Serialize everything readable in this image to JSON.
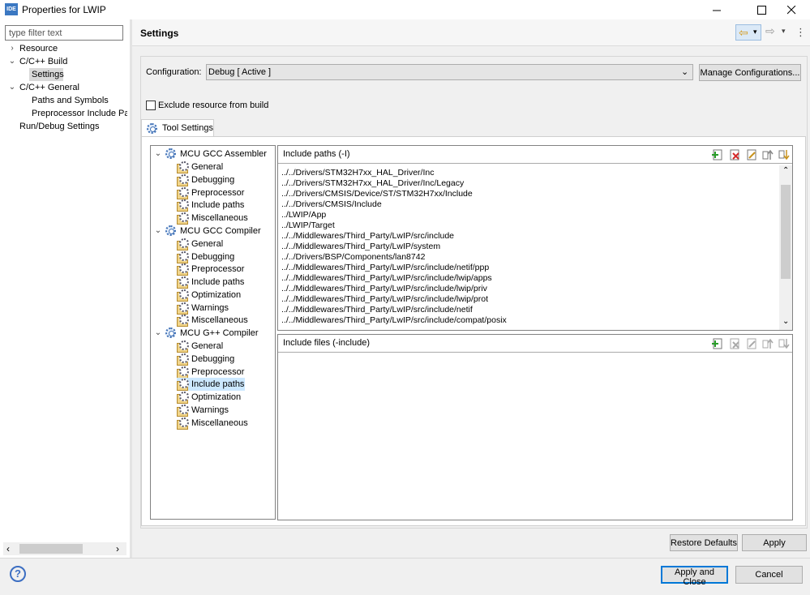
{
  "window": {
    "app_icon_text": "IDE",
    "title": "Properties for LWIP",
    "minimize_glyph": "—",
    "maximize_glyph": "☐",
    "close_glyph": "✕"
  },
  "left": {
    "filter_placeholder": "type filter text",
    "tree": [
      {
        "label": "Resource",
        "twisty": "›"
      },
      {
        "label": "C/C++ Build",
        "twisty": "⌄"
      },
      {
        "label": "Settings",
        "twisty": ""
      },
      {
        "label": "C/C++ General",
        "twisty": "⌄"
      },
      {
        "label": "Paths and Symbols",
        "twisty": ""
      },
      {
        "label": "Preprocessor Include Pat",
        "twisty": ""
      },
      {
        "label": "Run/Debug Settings",
        "twisty": ""
      }
    ],
    "scroll_left": "‹",
    "scroll_right": "›"
  },
  "settings": {
    "title": "Settings",
    "nav_back": "⇦",
    "nav_forward": "⇨",
    "nav_menu": "▾",
    "nav_more": "⋮",
    "configuration_label": "Configuration:",
    "configuration_value": "Debug  [ Active ]",
    "dropdown_arrow": "⌄",
    "manage_button": "Manage Configurations...",
    "exclude_label": "Exclude resource from build",
    "tab_label": "Tool Settings"
  },
  "tool_tree": {
    "groups": [
      {
        "label": "MCU GCC Assembler",
        "items": [
          "General",
          "Debugging",
          "Preprocessor",
          "Include paths",
          "Miscellaneous"
        ]
      },
      {
        "label": "MCU GCC Compiler",
        "items": [
          "General",
          "Debugging",
          "Preprocessor",
          "Include paths",
          "Optimization",
          "Warnings",
          "Miscellaneous"
        ]
      },
      {
        "label": "MCU G++ Compiler",
        "items": [
          "General",
          "Debugging",
          "Preprocessor",
          "Include paths",
          "Optimization",
          "Warnings",
          "Miscellaneous"
        ]
      }
    ],
    "expander": "⌄",
    "selected": "MCU G++ Compiler/Include paths"
  },
  "include_paths": {
    "title": "Include paths (-I)",
    "paths": [
      "../../Drivers/STM32H7xx_HAL_Driver/Inc",
      "../../Drivers/STM32H7xx_HAL_Driver/Inc/Legacy",
      "../../Drivers/CMSIS/Device/ST/STM32H7xx/Include",
      "../../Drivers/CMSIS/Include",
      "../LWIP/App",
      "../LWIP/Target",
      "../../Middlewares/Third_Party/LwIP/src/include",
      "../../Middlewares/Third_Party/LwIP/system",
      "../../Drivers/BSP/Components/lan8742",
      "../../Middlewares/Third_Party/LwIP/src/include/netif/ppp",
      "../../Middlewares/Third_Party/LwIP/src/include/lwip/apps",
      "../../Middlewares/Third_Party/LwIP/src/include/lwip/priv",
      "../../Middlewares/Third_Party/LwIP/src/include/lwip/prot",
      "../../Middlewares/Third_Party/LwIP/src/include/netif",
      "../../Middlewares/Third_Party/LwIP/src/include/compat/posix"
    ],
    "scroll_up": "⌃",
    "scroll_down": "⌄"
  },
  "include_files": {
    "title": "Include files (-include)"
  },
  "buttons": {
    "restore_defaults": "Restore Defaults",
    "apply": "Apply",
    "apply_and_close": "Apply and Close",
    "cancel": "Cancel"
  },
  "help": {
    "glyph": "?"
  },
  "colors": {
    "accent": "#0078d7",
    "selection": "#cce8ff",
    "add_green": "#2a9d2a",
    "delete_red": "#d42a2a"
  }
}
